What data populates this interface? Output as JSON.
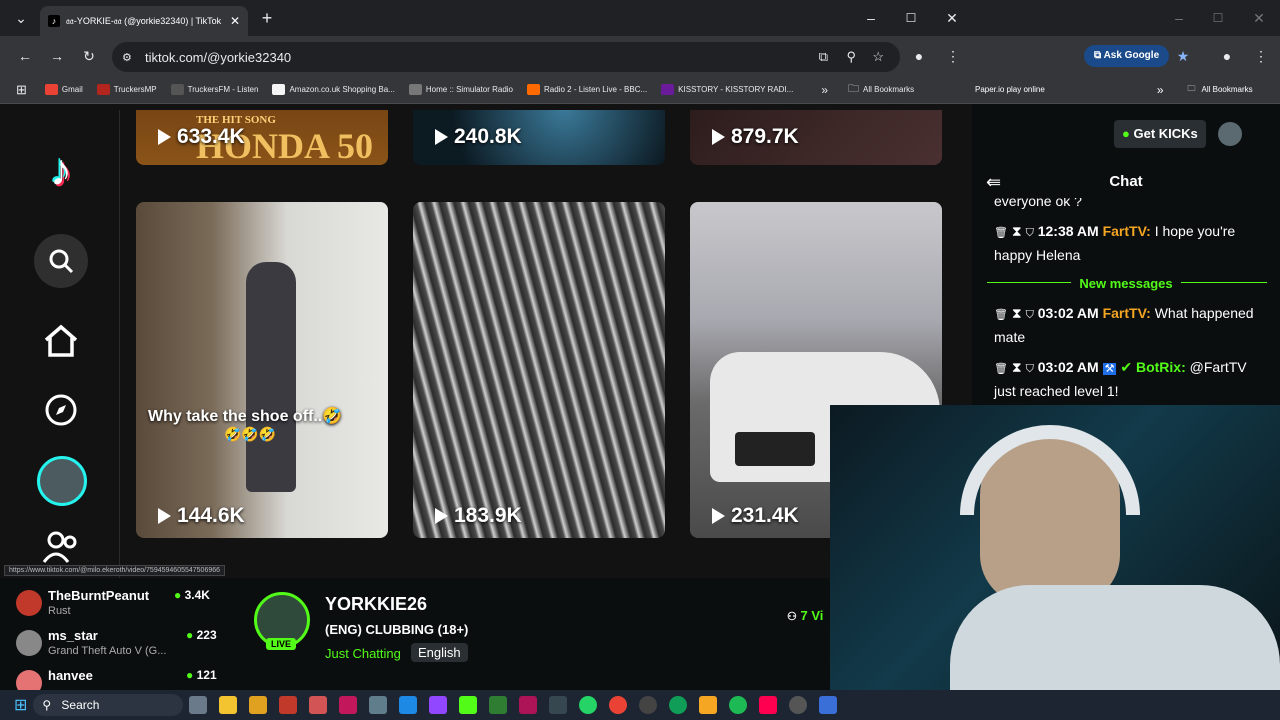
{
  "left_window": {
    "tab_title": "𝔞𝔞-YORKIE-𝔞𝔞 (@yorkie32340) | TikTok",
    "url": "tiktok.com/@yorkie32340",
    "bookmarks": [
      {
        "label": "Gmail",
        "color": "#ea4335"
      },
      {
        "label": "TruckersMP",
        "color": "#b3261e"
      },
      {
        "label": "TruckersFM - Listen",
        "color": "#555"
      },
      {
        "label": "Amazon.co.uk Shopping Ba...",
        "color": "#f5f5f5"
      },
      {
        "label": "Home :: Simulator Radio",
        "color": "#777"
      },
      {
        "label": "Radio 2 - Listen Live - BBC...",
        "color": "#ff6a00"
      },
      {
        "label": "KISSTORY - KISSTORY RADI...",
        "color": "#6a1b9a"
      }
    ],
    "all_bookmarks": "All Bookmarks",
    "status_url": "https://www.tiktok.com/@milo.ekeroth/video/7594594605547506966"
  },
  "tiktok": {
    "videos_top": [
      {
        "views": "633.4K",
        "caption": "THE HIT SONG",
        "caption2": "HONDA 50"
      },
      {
        "views": "240.8K"
      },
      {
        "views": "879.7K"
      }
    ],
    "videos_mid": [
      {
        "views": "144.6K",
        "caption": "Why take the shoe off..🤣",
        "caption2": "🤣🤣🤣"
      },
      {
        "views": "183.9K"
      },
      {
        "views": "231.4K"
      }
    ]
  },
  "right_window": {
    "bookmark": "Paper.io play online",
    "all_bookmarks": "All Bookmarks",
    "ask_google": "Ask Google",
    "get_kicks": "Get KICKs",
    "chat_title": "Chat",
    "chat_top_fragment": "everyone ok ?",
    "messages": [
      {
        "time": "12:38 AM",
        "user": "FartTV",
        "user_color": "#f5a623",
        "text": "I hope you're happy Helena"
      },
      {
        "time": "03:02 AM",
        "user": "FartTV",
        "user_color": "#f5a623",
        "text": "What happened mate"
      },
      {
        "time": "03:02 AM",
        "user": "BotRix",
        "user_color": "#53fc18",
        "text": "@FartTV just reached level 1!"
      }
    ],
    "new_messages": "New messages"
  },
  "kick": {
    "streamer": "YORKKIE26",
    "stream_title": "(ENG) CLUBBING (18+)",
    "category": "Just Chatting",
    "language": "English",
    "live_badge": "LIVE",
    "viewers_fragment": "7 Vi",
    "recommended": [
      {
        "name": "TheBurntPeanut",
        "game": "Rust",
        "viewers": "3.4K"
      },
      {
        "name": "ms_star",
        "game": "Grand Theft Auto V (G...",
        "viewers": "223"
      },
      {
        "name": "hanvee",
        "game": "",
        "viewers": "121"
      }
    ]
  },
  "taskbar": {
    "search_label": "Search"
  },
  "colors": {
    "kick_green": "#53fc18",
    "tiktok_bg": "#121212"
  }
}
